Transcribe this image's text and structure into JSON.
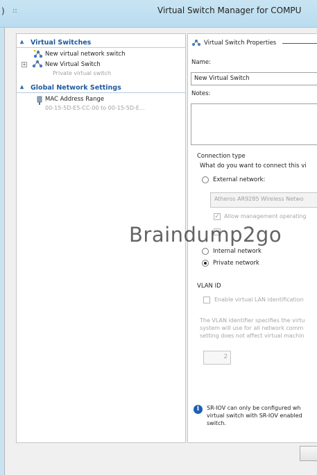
{
  "title_bar": {
    "glyph": "::",
    "title": "Virtual Switch Manager for COMPU",
    "edge_char": ")"
  },
  "tree": {
    "virtual_switches": {
      "header": "Virtual Switches",
      "items": [
        {
          "label": "New virtual network switch",
          "sub": ""
        },
        {
          "label": "New Virtual Switch",
          "sub": "Private virtual switch"
        }
      ]
    },
    "global_network": {
      "header": "Global Network Settings",
      "items": [
        {
          "label": "MAC Address Range",
          "sub": "00-15-5D-E5-CC-00 to 00-15-5D-E..."
        }
      ]
    }
  },
  "properties": {
    "group_title": "Virtual Switch Properties",
    "name_label": "Name:",
    "name_value": "New Virtual Switch",
    "notes_label": "Notes:",
    "notes_value": "",
    "connection_type_label": "Connection type",
    "connection_question": "What do you want to connect this vi",
    "external_network_label": "External network:",
    "external_adapter": "Atheros AR9285 Wireless Netwo",
    "allow_management": "Allow management operating",
    "internal_network_label": "Internal network",
    "private_network_label": "Private network",
    "selected_connection": "private",
    "vlan_id_label": "VLAN ID",
    "vlan_enable_label": "Enable virtual LAN identification",
    "vlan_desc_lines": [
      "The VLAN identifier specifies the virtu",
      "system will use for all network comm",
      "setting does not affect virtual machin"
    ],
    "vlan_value": "2",
    "sriov_lines": [
      "SR-IOV can only be configured wh",
      "virtual switch with SR-IOV enabled",
      "switch."
    ]
  },
  "watermark": "Braindump2go",
  "colors": {
    "title_bar": "#c9e3f2",
    "section_header": "#1f5b9e",
    "info_icon": "#1d5fb2"
  }
}
